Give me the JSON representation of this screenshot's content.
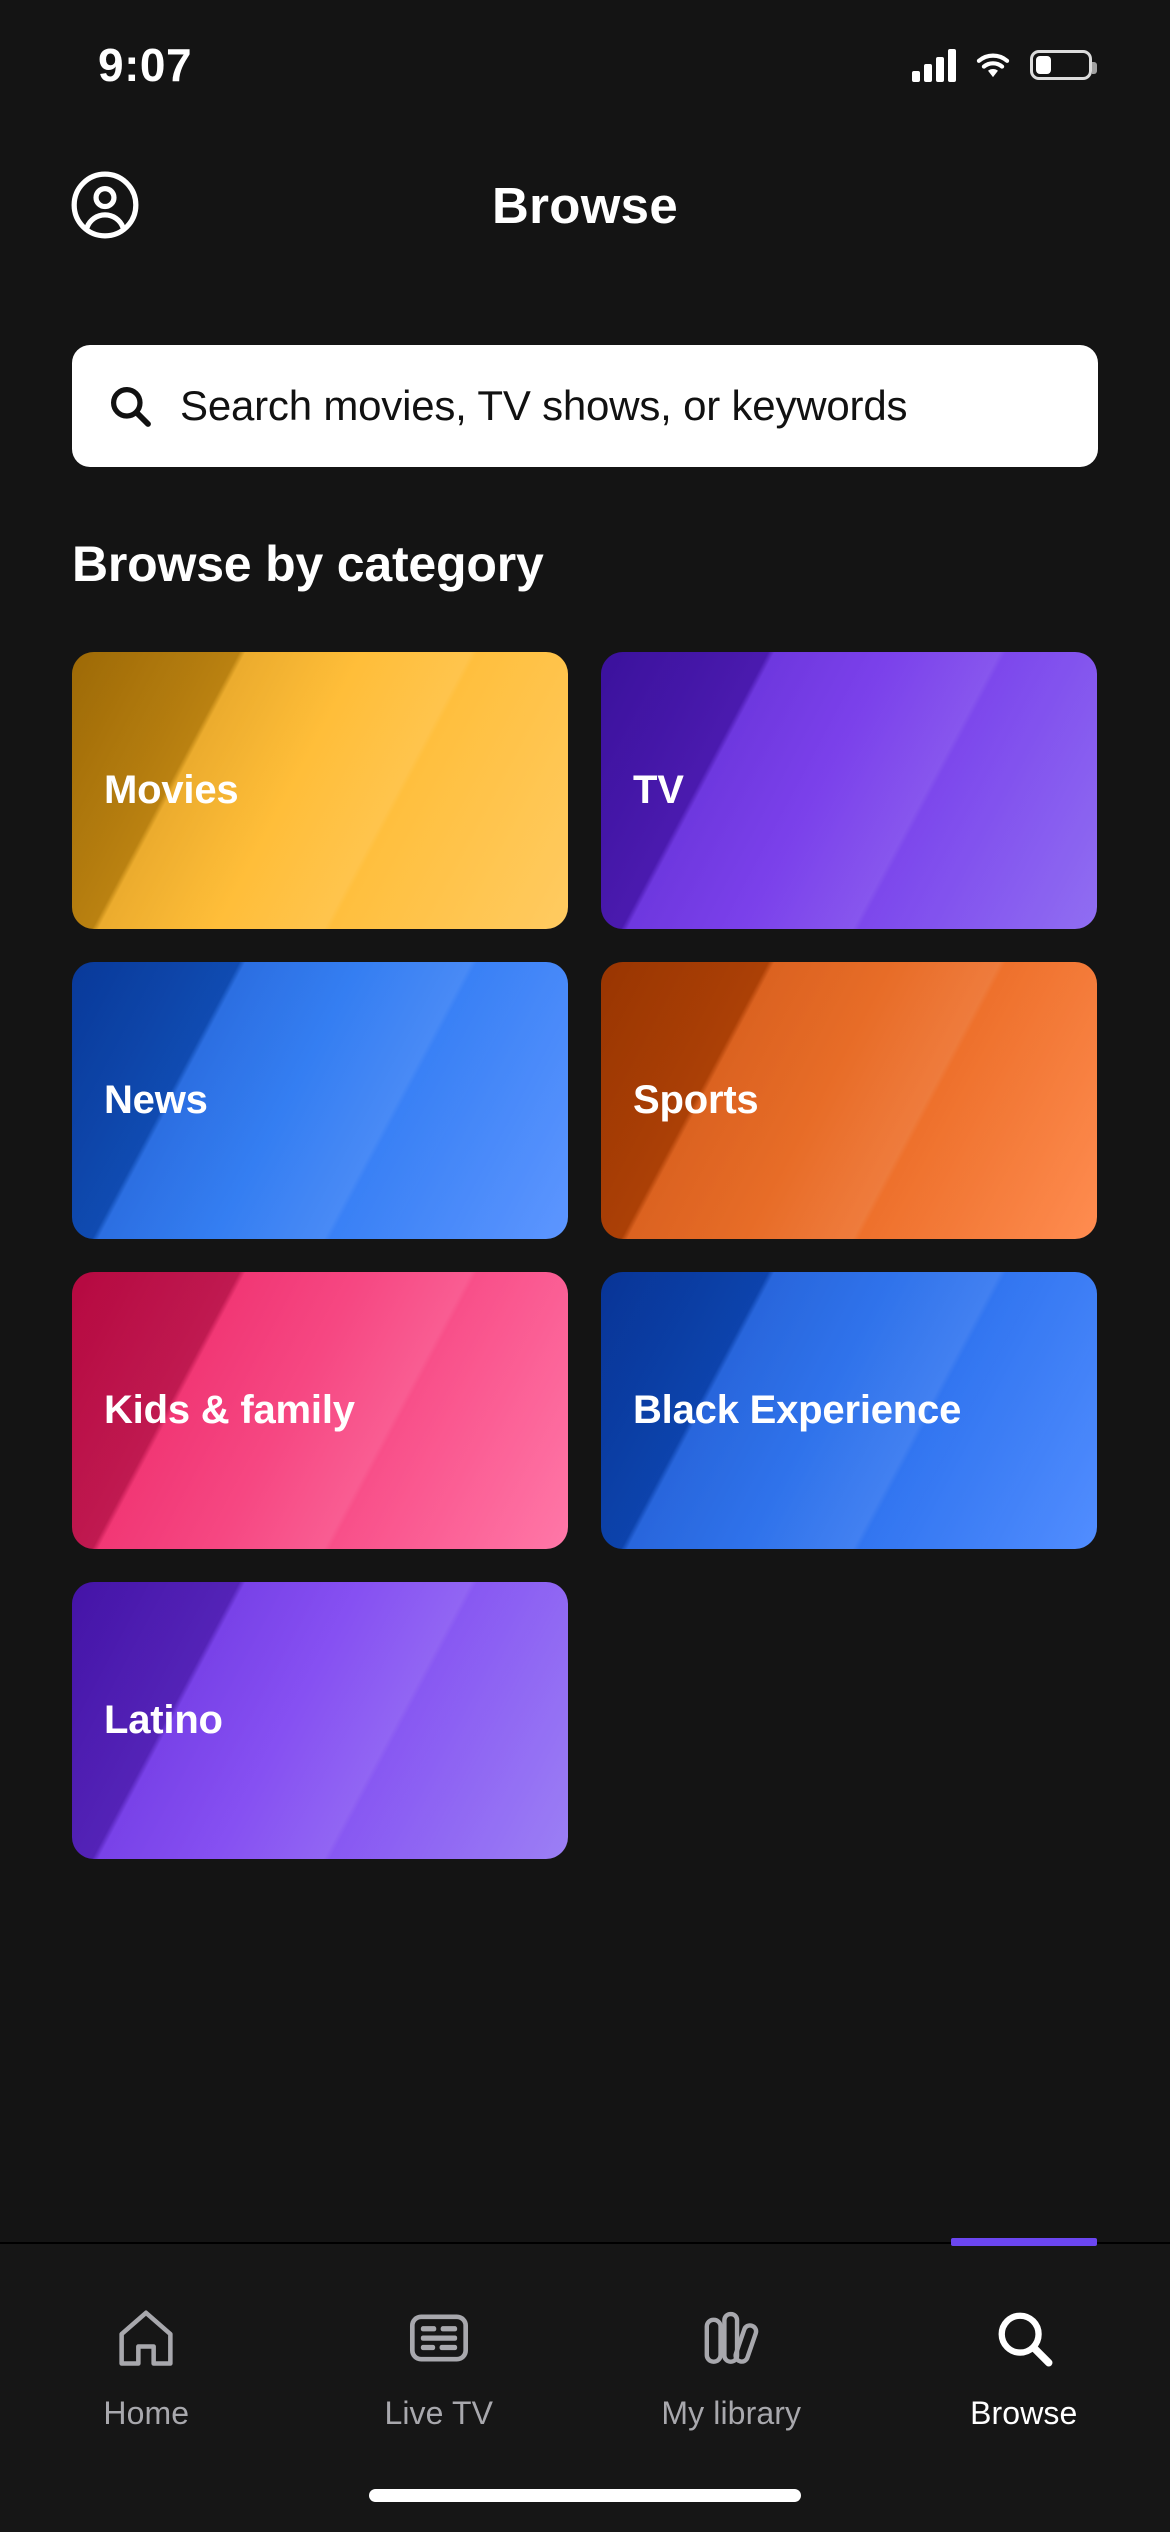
{
  "status_bar": {
    "time": "9:07",
    "cellular_icon": "cellular-signal-icon",
    "wifi_icon": "wifi-icon",
    "battery_icon": "battery-icon",
    "battery_level_percent": 30
  },
  "header": {
    "title": "Browse",
    "avatar_icon": "account-circle-icon"
  },
  "search": {
    "icon": "search-icon",
    "value": "",
    "placeholder": "Search movies, TV shows, or keywords",
    "background": "#ffffff",
    "text_color": "#111111"
  },
  "browse": {
    "section_title": "Browse by category",
    "categories": [
      {
        "label": "Movies",
        "gradient_from": "#C98708",
        "gradient_to": "#FFCA5E",
        "accent": "#FFB51F"
      },
      {
        "label": "TV",
        "gradient_from": "#4B16C8",
        "gradient_to": "#8E6BF2",
        "accent": "#6A28E8"
      },
      {
        "label": "News",
        "gradient_from": "#0B49C4",
        "gradient_to": "#5A94FF",
        "accent": "#1A6DF0"
      },
      {
        "label": "Sports",
        "gradient_from": "#C44402",
        "gradient_to": "#FF8A4D",
        "accent": "#E4590B"
      },
      {
        "label": "Kids & family",
        "gradient_from": "#E80B52",
        "gradient_to": "#FF75A6",
        "accent": "#F52F72"
      },
      {
        "label": "Black Experience",
        "gradient_from": "#0A43C0",
        "gradient_to": "#4E8BFF",
        "accent": "#1460E8"
      },
      {
        "label": "Latino",
        "gradient_from": "#5719D6",
        "gradient_to": "#9A7DF5",
        "accent": "#7639F0"
      }
    ]
  },
  "tabbar": {
    "active_indicator_color": "#6B46F0",
    "items": [
      {
        "label": "Home",
        "icon": "home-icon",
        "active": false
      },
      {
        "label": "Live TV",
        "icon": "live-tv-icon",
        "active": false
      },
      {
        "label": "My library",
        "icon": "my-library-icon",
        "active": false
      },
      {
        "label": "Browse",
        "icon": "search-icon",
        "active": true
      }
    ]
  },
  "home_indicator": "home-indicator-bar"
}
